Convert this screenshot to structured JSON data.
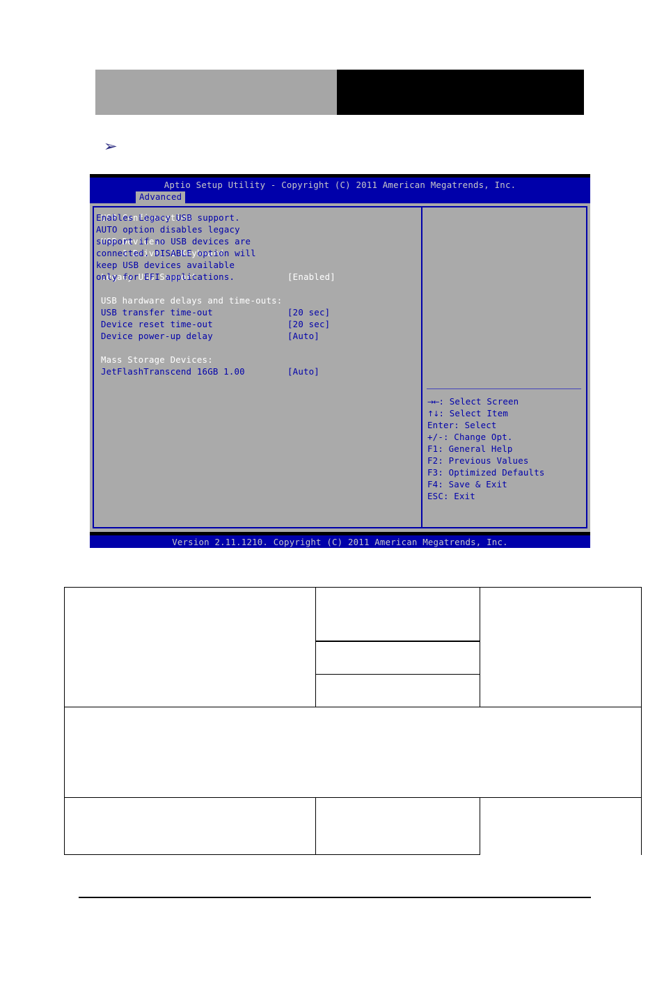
{
  "page": {
    "header_banner": {
      "left_block_color": "#a6a6a6",
      "right_block_color": "#000000",
      "left_block_text": "",
      "right_block_text": ""
    },
    "bullet": {
      "glyph": "➢",
      "text": ""
    },
    "bottom_rule_color": "#000000"
  },
  "bios": {
    "title": "Aptio Setup Utility - Copyright (C) 2011 American Megatrends, Inc.",
    "tab": "Advanced",
    "colors": {
      "blue": "#0000aa",
      "gray": "#aaaaaa",
      "white": "#ffffff",
      "title_text": "#c8c8c8"
    },
    "left_panel": {
      "lines": [
        {
          "label": "USB Configuration",
          "value": "",
          "style": "white"
        },
        {
          "label": "",
          "value": "",
          "style": "spacer"
        },
        {
          "label": "USB Devices:",
          "value": "",
          "style": "white"
        },
        {
          "label": "    1 Drive, 1 Keyboard",
          "value": "",
          "style": "white"
        },
        {
          "label": "",
          "value": "",
          "style": "spacer"
        },
        {
          "label": "Legacy USB Support",
          "value": "[Enabled]",
          "style": "white"
        },
        {
          "label": "",
          "value": "",
          "style": "spacer"
        },
        {
          "label": "USB hardware delays and time-outs:",
          "value": "",
          "style": "white"
        },
        {
          "label": "USB transfer time-out",
          "value": "[20 sec]",
          "style": "blue"
        },
        {
          "label": "Device reset time-out",
          "value": "[20 sec]",
          "style": "blue"
        },
        {
          "label": "Device power-up delay",
          "value": "[Auto]",
          "style": "blue"
        },
        {
          "label": "",
          "value": "",
          "style": "spacer"
        },
        {
          "label": "Mass Storage Devices:",
          "value": "",
          "style": "white"
        },
        {
          "label": "JetFlashTranscend 16GB 1.00",
          "value": "[Auto]",
          "style": "blue"
        }
      ]
    },
    "right_panel": {
      "help_lines": [
        "Enables Legacy USB support.",
        "AUTO option disables legacy",
        "support if no USB devices are",
        "connected. DISABLE option will",
        "keep USB devices available",
        "only for EFI applications."
      ],
      "key_legend": [
        {
          "glyph": "→←",
          "text": ": Select Screen"
        },
        {
          "glyph": "↑↓",
          "text": ": Select Item"
        },
        {
          "glyph": "",
          "text": "Enter: Select"
        },
        {
          "glyph": "",
          "text": "+/-: Change Opt."
        },
        {
          "glyph": "",
          "text": "F1: General Help"
        },
        {
          "glyph": "",
          "text": "F2: Previous Values"
        },
        {
          "glyph": "",
          "text": "F3: Optimized Defaults"
        },
        {
          "glyph": "",
          "text": "F4: Save & Exit"
        },
        {
          "glyph": "",
          "text": "ESC: Exit"
        }
      ]
    },
    "footer": "Version 2.11.1210. Copyright (C) 2011 American Megatrends, Inc."
  },
  "spec_table": {
    "rows": [
      {
        "cells": [
          "",
          "",
          ""
        ]
      },
      {
        "cells": [
          "",
          "",
          ""
        ]
      },
      {
        "cells": [
          "",
          "",
          ""
        ]
      },
      {
        "cells": [
          ""
        ]
      },
      {
        "cells": [
          "",
          "",
          ""
        ]
      }
    ]
  }
}
